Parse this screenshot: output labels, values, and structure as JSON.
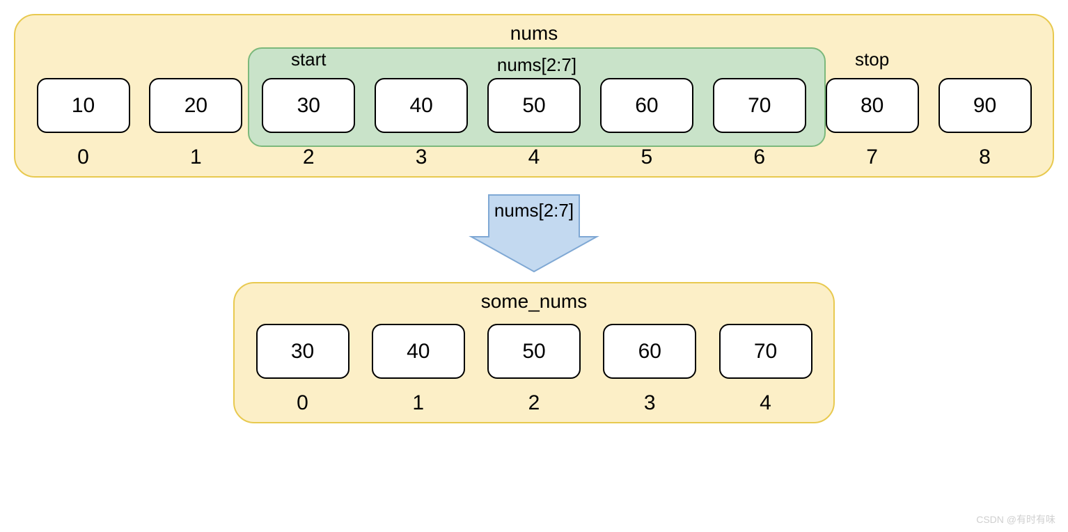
{
  "top": {
    "title": "nums",
    "slice_title": "nums[2:7]",
    "start_label": "start",
    "stop_label": "stop",
    "values": [
      "10",
      "20",
      "30",
      "40",
      "50",
      "60",
      "70",
      "80",
      "90"
    ],
    "indices": [
      "0",
      "1",
      "2",
      "3",
      "4",
      "5",
      "6",
      "7",
      "8"
    ],
    "slice_start": 2,
    "slice_end": 6
  },
  "arrow": {
    "label": "nums[2:7]"
  },
  "bottom": {
    "title": "some_nums",
    "values": [
      "30",
      "40",
      "50",
      "60",
      "70"
    ],
    "indices": [
      "0",
      "1",
      "2",
      "3",
      "4"
    ]
  },
  "watermark": "CSDN @有时有味",
  "colors": {
    "outer_fill": "#fcefc7",
    "outer_border": "#e8c94f",
    "slice_fill": "#c9e3c9",
    "slice_border": "#7bb87b",
    "arrow_fill": "#c3d9f0",
    "arrow_border": "#7fa8d4"
  }
}
